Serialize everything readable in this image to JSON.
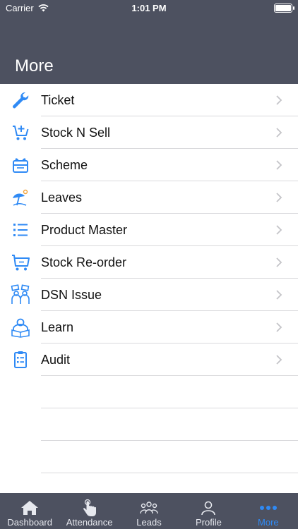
{
  "status_bar": {
    "carrier": "Carrier",
    "time": "1:01 PM"
  },
  "header": {
    "title": "More"
  },
  "menu": {
    "items": [
      {
        "label": "Ticket",
        "icon": "wrench-icon"
      },
      {
        "label": "Stock N Sell",
        "icon": "cart-plus-icon"
      },
      {
        "label": "Scheme",
        "icon": "gift-box-icon"
      },
      {
        "label": "Leaves",
        "icon": "beach-umbrella-icon"
      },
      {
        "label": "Product Master",
        "icon": "list-icon"
      },
      {
        "label": "Stock Re-order",
        "icon": "cart-icon"
      },
      {
        "label": "DSN Issue",
        "icon": "people-issue-icon"
      },
      {
        "label": "Learn",
        "icon": "reader-icon"
      },
      {
        "label": "Audit",
        "icon": "clipboard-icon"
      }
    ]
  },
  "tab_bar": {
    "tabs": [
      {
        "label": "Dashboard",
        "icon": "home-icon"
      },
      {
        "label": "Attendance",
        "icon": "hand-touch-icon"
      },
      {
        "label": "Leads",
        "icon": "group-icon"
      },
      {
        "label": "Profile",
        "icon": "person-icon"
      },
      {
        "label": "More",
        "icon": "more-dots-icon",
        "active": true
      }
    ]
  },
  "colors": {
    "header_bg": "#4d5160",
    "accent": "#2f8af5",
    "icon_blue": "#2f8af5"
  }
}
